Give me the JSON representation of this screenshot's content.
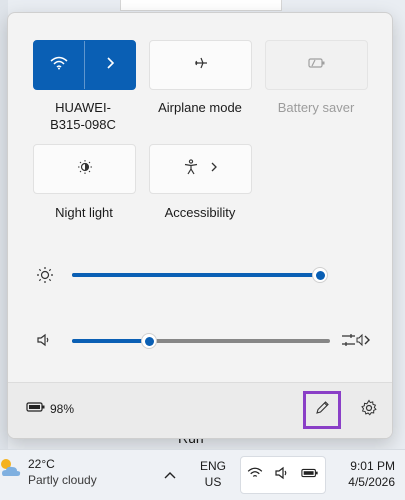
{
  "tiles": {
    "wifi": {
      "label": "HUAWEI-\nB315-098C",
      "label_line1": "HUAWEI-",
      "label_line2": "B315-098C",
      "active": true
    },
    "airplane": {
      "label": "Airplane mode"
    },
    "battery_saver": {
      "label": "Battery saver",
      "disabled": true
    },
    "night_light": {
      "label": "Night light"
    },
    "accessibility": {
      "label": "Accessibility"
    }
  },
  "sliders": {
    "brightness": {
      "value_fraction": 1.0
    },
    "volume": {
      "value_fraction": 0.3
    }
  },
  "footer": {
    "battery_text": "98%"
  },
  "background": {
    "run_text": "Run"
  },
  "taskbar": {
    "weather_temp": "22°C",
    "weather_condition": "Partly cloudy",
    "lang_line1": "ENG",
    "lang_line2": "US",
    "time": "9:01 PM",
    "date": "4/5/2026"
  },
  "colors": {
    "accent": "#0a5fb4",
    "highlight_border": "#8a3fc7"
  },
  "icons": [
    "wifi-icon",
    "chevron-right-icon",
    "airplane-icon",
    "battery-saver-icon",
    "night-light-icon",
    "accessibility-icon",
    "brightness-icon",
    "speaker-icon",
    "audio-output-icon",
    "battery-icon",
    "pencil-icon",
    "gear-icon",
    "weather-icon",
    "chevron-up-icon"
  ]
}
